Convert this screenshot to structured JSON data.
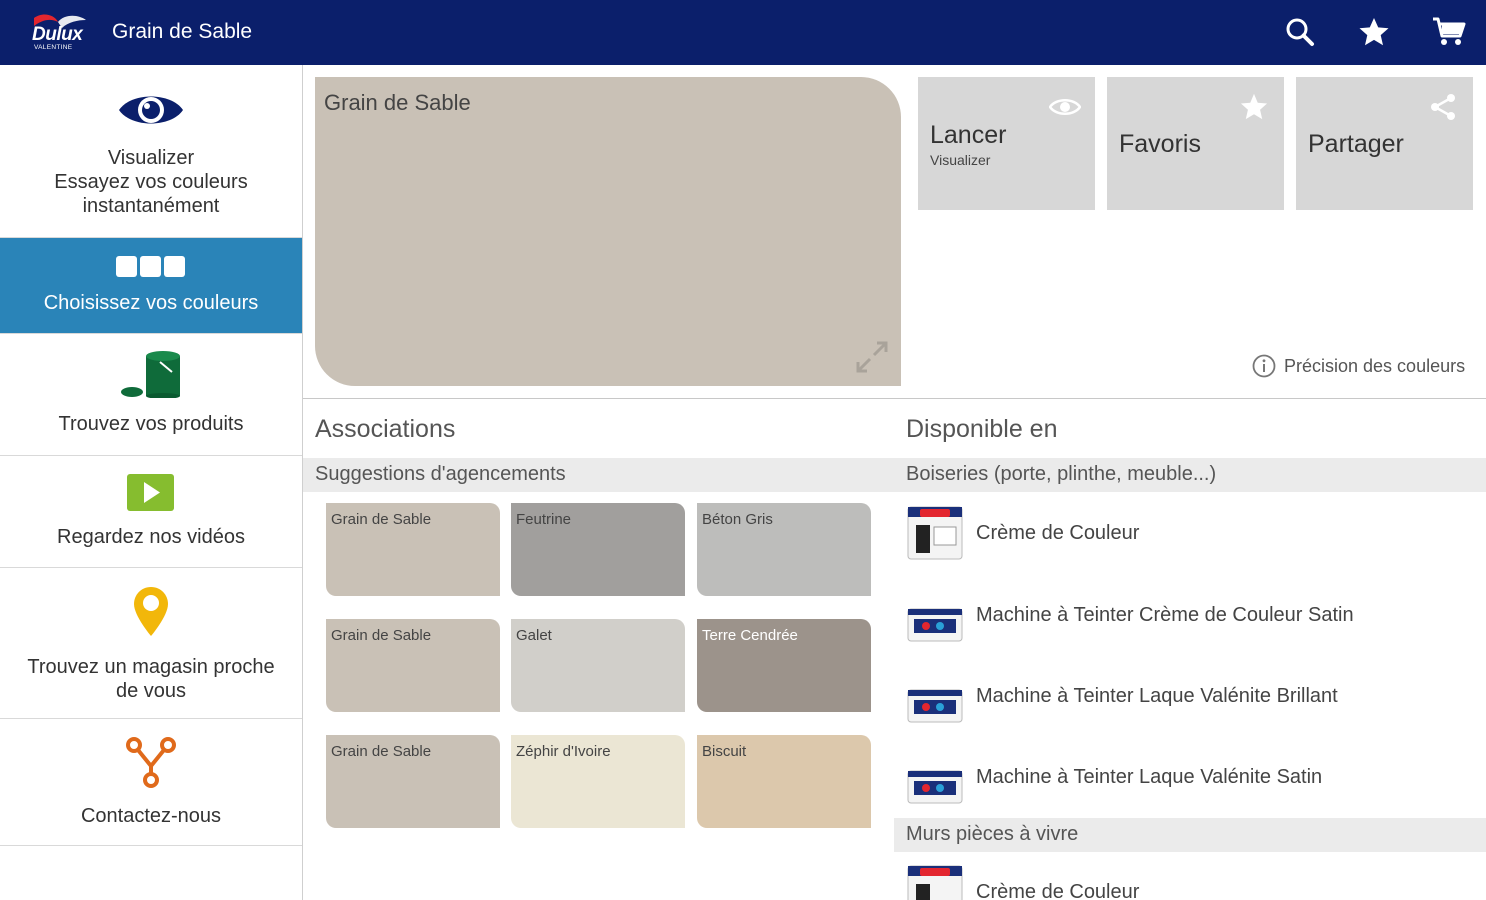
{
  "header": {
    "logo_text": "Dulux",
    "logo_subtext": "VALENTINE",
    "title": "Grain de Sable",
    "icons": [
      "search-icon",
      "star-icon",
      "cart-icon"
    ]
  },
  "sidebar": {
    "items": [
      {
        "label_lines": [
          "Visualizer",
          "Essayez vos couleurs",
          "instantanément"
        ],
        "icon": "eye-icon",
        "active": false
      },
      {
        "label_lines": [
          "Choisissez vos couleurs"
        ],
        "icon": "swatches-icon",
        "active": true
      },
      {
        "label_lines": [
          "Trouvez vos produits"
        ],
        "icon": "paint-can-icon",
        "active": false
      },
      {
        "label_lines": [
          "Regardez nos vidéos"
        ],
        "icon": "play-icon",
        "active": false
      },
      {
        "label_lines": [
          "Trouvez un magasin proche",
          "de vous"
        ],
        "icon": "map-pin-icon",
        "active": false
      },
      {
        "label_lines": [
          "Contactez-nous"
        ],
        "icon": "connect-icon",
        "active": false
      }
    ]
  },
  "hero": {
    "title": "Grain de Sable",
    "color": "#c9c1b6"
  },
  "actions": [
    {
      "label": "Lancer",
      "sub": "Visualizer",
      "icon": "eye-icon"
    },
    {
      "label": "Favoris",
      "sub": "",
      "icon": "star-icon"
    },
    {
      "label": "Partager",
      "sub": "",
      "icon": "share-icon"
    }
  ],
  "precision_label": "Précision des couleurs",
  "associations": {
    "title": "Associations",
    "subtitle": "Suggestions d'agencements",
    "swatches": [
      {
        "name": "Grain de Sable",
        "color": "#c9c1b6"
      },
      {
        "name": "Feutrine",
        "color": "#a19f9d"
      },
      {
        "name": "Béton Gris",
        "color": "#bdbdbb"
      },
      {
        "name": "Grain de Sable",
        "color": "#c9c1b6"
      },
      {
        "name": "Galet",
        "color": "#d1cfca"
      },
      {
        "name": "Terre Cendrée",
        "color": "#9c938b"
      },
      {
        "name": "Grain de Sable",
        "color": "#c9c1b6"
      },
      {
        "name": "Zéphir d'Ivoire",
        "color": "#ebe6d4"
      },
      {
        "name": "Biscuit",
        "color": "#dcc8ac"
      }
    ]
  },
  "availability": {
    "title": "Disponible en",
    "groups": [
      {
        "label": "Boiseries (porte, plinthe, meuble...)",
        "products": [
          "Crème de Couleur",
          "Machine à Teinter Crème de Couleur Satin",
          "Machine à Teinter Laque Valénite Brillant",
          "Machine à Teinter Laque Valénite Satin"
        ]
      },
      {
        "label": "Murs pièces à vivre",
        "products": [
          "Crème de Couleur"
        ]
      }
    ]
  },
  "colors": {
    "header_bg": "#0b1f6b",
    "active_nav": "#2a84b8",
    "tile_bg": "#d7d7d7"
  }
}
